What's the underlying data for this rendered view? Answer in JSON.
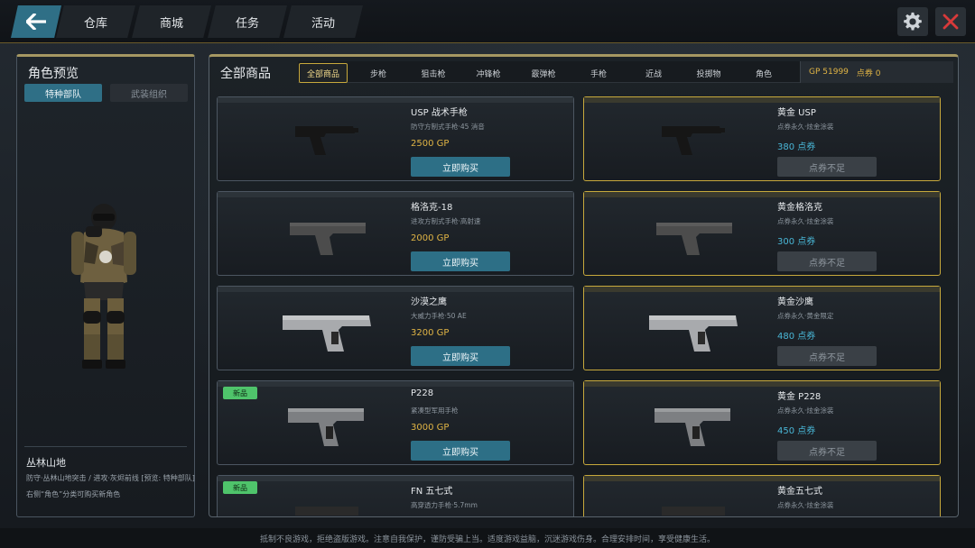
{
  "colors": {
    "accent": "#2f6f86",
    "gold": "#c7a93c",
    "gp": "#e0b445",
    "points": "#49b6d6",
    "new_badge": "#4fc46b",
    "close": "#d83a3a"
  },
  "topnav": {
    "tabs": [
      "仓库",
      "商城",
      "任务",
      "活动"
    ]
  },
  "left": {
    "title": "角色预览",
    "tabs": [
      "特种部队",
      "武装组织"
    ],
    "character_name": "丛林山地",
    "character_desc": "防守·丛林山地突击 / 进攻·灰烬前线 [预览: 特种部队]",
    "hint": "右侧“角色”分类可购买新角色"
  },
  "main": {
    "title": "全部商品",
    "categories": [
      "全部商品",
      "步枪",
      "狙击枪",
      "冲锋枪",
      "霰弹枪",
      "手枪",
      "近战",
      "投掷物",
      "角色"
    ],
    "currency": {
      "gp": "GP 51999",
      "points": "点券 0"
    },
    "items": [
      {
        "name": "USP 战术手枪",
        "desc": "防守方制式手枪·45 消音",
        "price": "2500 GP",
        "button": "立即购买",
        "new": false,
        "gold": false
      },
      {
        "name": "黄金 USP",
        "desc": "点券永久·炫金涂装",
        "price": "380 点券",
        "button": "点券不足",
        "new": false,
        "gold": true
      },
      {
        "name": "格洛克-18",
        "desc": "进攻方制式手枪·高射速",
        "price": "2000 GP",
        "button": "立即购买",
        "new": false,
        "gold": false
      },
      {
        "name": "黄金格洛克",
        "desc": "点券永久·炫金涂装",
        "price": "300 点券",
        "button": "点券不足",
        "new": false,
        "gold": true
      },
      {
        "name": "沙漠之鹰",
        "desc": "大威力手枪·50 AE",
        "price": "3200 GP",
        "button": "立即购买",
        "new": false,
        "gold": false
      },
      {
        "name": "黄金沙鹰",
        "desc": "点券永久·黄金限定",
        "price": "480 点券",
        "button": "点券不足",
        "new": false,
        "gold": true
      },
      {
        "name": "P228",
        "desc": "紧凑型军用手枪",
        "price": "3000 GP",
        "button": "立即购买",
        "new": true,
        "badge": "新品",
        "gold": false
      },
      {
        "name": "黄金 P228",
        "desc": "点券永久·炫金涂装",
        "price": "450 点券",
        "button": "点券不足",
        "new": false,
        "gold": true
      },
      {
        "name": "FN 五七式",
        "desc": "高穿透力手枪·5.7mm",
        "new": true,
        "badge": "新品",
        "gold": false
      },
      {
        "name": "黄金五七式",
        "desc": "点券永久·炫金涂装",
        "new": false,
        "gold": true
      }
    ]
  },
  "footer": "抵制不良游戏，拒绝盗版游戏。注意自我保护，谨防受骗上当。适度游戏益脑，沉迷游戏伤身。合理安排时间，享受健康生活。"
}
